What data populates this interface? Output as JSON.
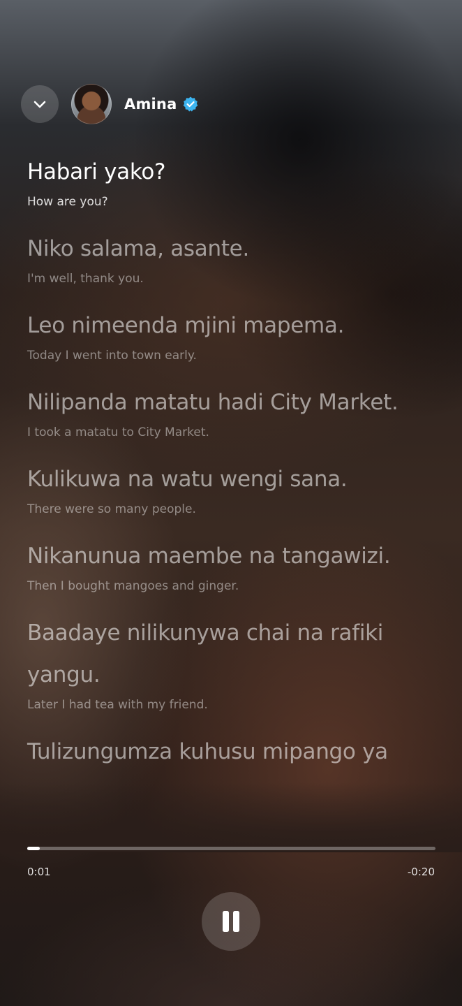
{
  "header": {
    "name": "Amina",
    "verified": true,
    "back_icon": "chevron-down-icon",
    "badge_icon": "verified-badge-icon",
    "badge_color": "#3cb4f0"
  },
  "lyrics": [
    {
      "text": "Habari yako?",
      "translation": "How are you?",
      "active": true
    },
    {
      "text": "Niko salama, asante.",
      "translation": "I'm well, thank you.",
      "active": false
    },
    {
      "text": "Leo nimeenda mjini mapema.",
      "translation": "Today I went into town early.",
      "active": false
    },
    {
      "text": "Nilipanda matatu hadi City Market.",
      "translation": "I took a matatu to City Market.",
      "active": false
    },
    {
      "text": "Kulikuwa na watu wengi sana.",
      "translation": "There were so many people.",
      "active": false
    },
    {
      "text": "Nikanunua maembe na tangawizi.",
      "translation": "Then I bought mangoes and ginger.",
      "active": false
    },
    {
      "text": "Baadaye nilikunywa chai na rafiki yangu.",
      "translation": "Later I had tea with my friend.",
      "active": false
    },
    {
      "text": "Tulizungumza kuhusu mipango ya",
      "translation": "",
      "active": false
    }
  ],
  "player": {
    "elapsed": "0:01",
    "remaining": "-0:20",
    "progress_fraction": 0.03,
    "pause_icon": "pause-icon"
  }
}
